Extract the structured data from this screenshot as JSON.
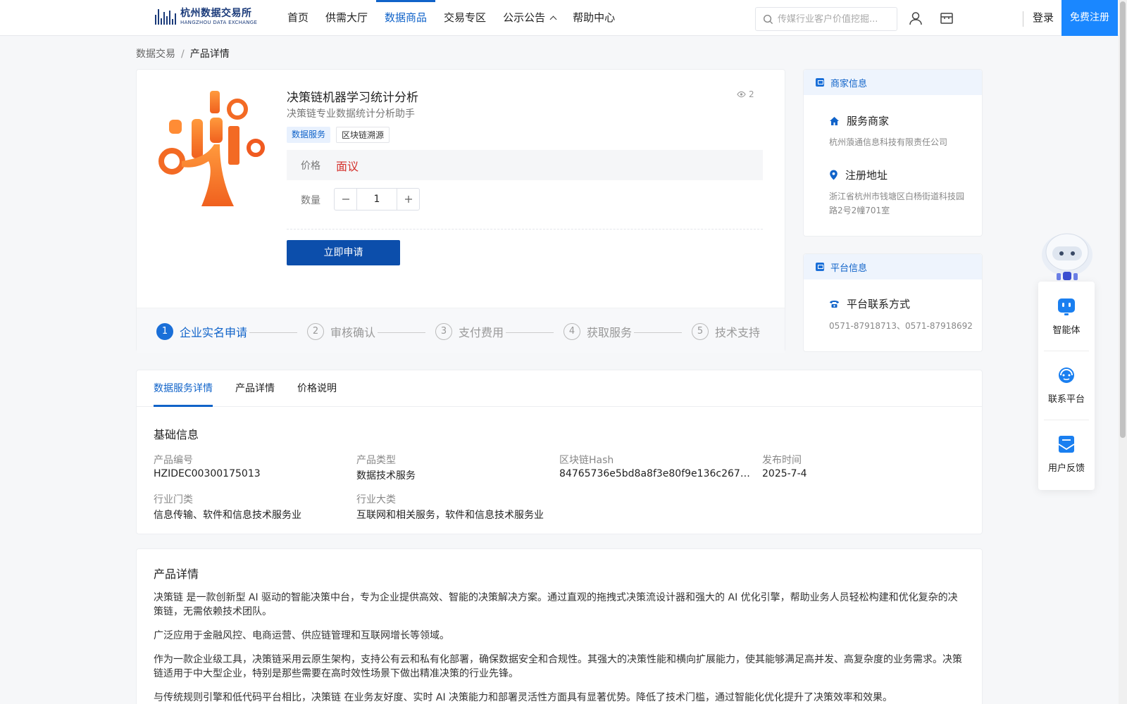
{
  "header": {
    "logo_cn": "杭州数据交易所",
    "logo_en": "HANGZHOU DATA EXCHANGE",
    "nav": [
      {
        "label": "首页",
        "active": false
      },
      {
        "label": "供需大厅",
        "active": false
      },
      {
        "label": "数据商品",
        "active": true
      },
      {
        "label": "交易专区",
        "active": false
      },
      {
        "label": "公示公告",
        "active": false,
        "has_dropdown": true
      },
      {
        "label": "帮助中心",
        "active": false
      }
    ],
    "search_placeholder": "传媒行业客户价值挖掘...",
    "login": "登录",
    "register": "免费注册",
    "accent_color": "#1063c9"
  },
  "breadcrumb": {
    "root": "数据交易",
    "sep": "/",
    "current": "产品详情"
  },
  "product": {
    "title": "决策链机器学习统计分析",
    "subtitle": "决策链专业数据统计分析助手",
    "views": "2",
    "tags": [
      "数据服务",
      "区块链溯源"
    ],
    "price_label": "价格",
    "price_value": "面议",
    "qty_label": "数量",
    "qty_value": "1",
    "apply_label": "立即申请",
    "steps": [
      {
        "num": "1",
        "label": "企业实名申请",
        "active": true
      },
      {
        "num": "2",
        "label": "审核确认",
        "active": false
      },
      {
        "num": "3",
        "label": "支付费用",
        "active": false
      },
      {
        "num": "4",
        "label": "获取服务",
        "active": false
      },
      {
        "num": "5",
        "label": "技术支持",
        "active": false
      }
    ]
  },
  "merchant": {
    "head": "商家信息",
    "provider_title": "服务商家",
    "provider_value": "杭州蒗通信息科技有限责任公司",
    "address_title": "注册地址",
    "address_value": "浙江省杭州市钱塘区白杨街道科技园路2号2幢701室"
  },
  "platform": {
    "head": "平台信息",
    "contact_title": "平台联系方式",
    "contact_value": "0571-87918713、0571-87918692"
  },
  "float": {
    "agent": "智能体",
    "contact": "联系平台",
    "feedback": "用户反馈"
  },
  "details": {
    "tabs": [
      "数据服务详情",
      "产品详情",
      "价格说明"
    ],
    "basic_title": "基础信息",
    "fields": [
      {
        "label": "产品编号",
        "value": "HZIDEC00300175013"
      },
      {
        "label": "产品类型",
        "value": "数据技术服务"
      },
      {
        "label": "区块链Hash",
        "value": "84765736e5bd8a8f3e80f9e136c2673d7af..."
      },
      {
        "label": "发布时间",
        "value": "2025-7-4"
      },
      {
        "label": "行业门类",
        "value": "信息传输、软件和信息技术服务业"
      },
      {
        "label": "行业大类",
        "value": "互联网和相关服务，软件和信息技术服务业"
      }
    ]
  },
  "description": {
    "title": "产品详情",
    "paragraphs": [
      "决策链 是一款创新型 AI 驱动的智能决策中台，专为企业提供高效、智能的决策解决方案。通过直观的拖拽式决策流设计器和强大的 AI 优化引擎，帮助业务人员轻松构建和优化复杂的决策链，无需依赖技术团队。",
      "广泛应用于金融风控、电商运营、供应链管理和互联网增长等领域。",
      "作为一款企业级工具，决策链采用云原生架构，支持公有云和私有化部署，确保数据安全和合规性。其强大的决策性能和横向扩展能力，使其能够满足高并发、高复杂度的业务需求。决策链适用于中大型企业，特别是那些需要在高时效性场景下做出精准决策的行业先锋。",
      "与传统规则引擎和低代码平台相比，决策链 在业务友好度、实时 AI 决策能力和部署灵活性方面具有显著优势。降低了技术门槛，通过智能化优化提升了决策效率和效果。"
    ]
  }
}
